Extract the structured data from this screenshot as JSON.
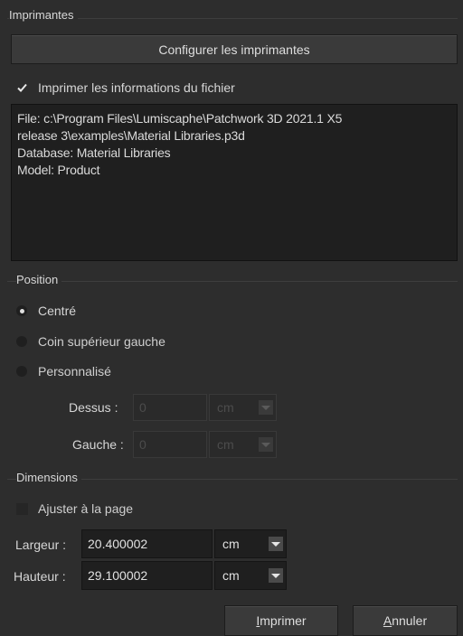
{
  "printers": {
    "group_title": "Imprimantes",
    "configure_button": "Configurer les imprimantes",
    "print_info_label": "Imprimer les informations du fichier",
    "print_info_checked": true,
    "info_lines": [
      "File: c:\\Program Files\\Lumiscaphe\\Patchwork 3D 2021.1 X5",
      "release 3\\examples\\Material Libraries.p3d",
      "Database: Material Libraries",
      "Model: Product"
    ]
  },
  "position": {
    "group_title": "Position",
    "options": [
      {
        "label": "Centré",
        "selected": true
      },
      {
        "label": "Coin supérieur gauche",
        "selected": false
      },
      {
        "label": "Personnalisé",
        "selected": false
      }
    ],
    "top_label": "Dessus :",
    "top_value": "0",
    "top_unit": "cm",
    "left_label": "Gauche :",
    "left_value": "0",
    "left_unit": "cm"
  },
  "dimensions": {
    "group_title": "Dimensions",
    "fit_page_label": "Ajuster à la page",
    "fit_page_checked": false,
    "width_label": "Largeur :",
    "width_value": "20.400002",
    "width_unit": "cm",
    "height_label": "Hauteur :",
    "height_value": "29.100002",
    "height_unit": "cm"
  },
  "footer": {
    "print_button": "Imprimer",
    "print_mnemonic": "I",
    "print_rest": "mprimer",
    "cancel_button": "Annuler",
    "cancel_mnemonic": "A",
    "cancel_rest": "nnuler"
  }
}
